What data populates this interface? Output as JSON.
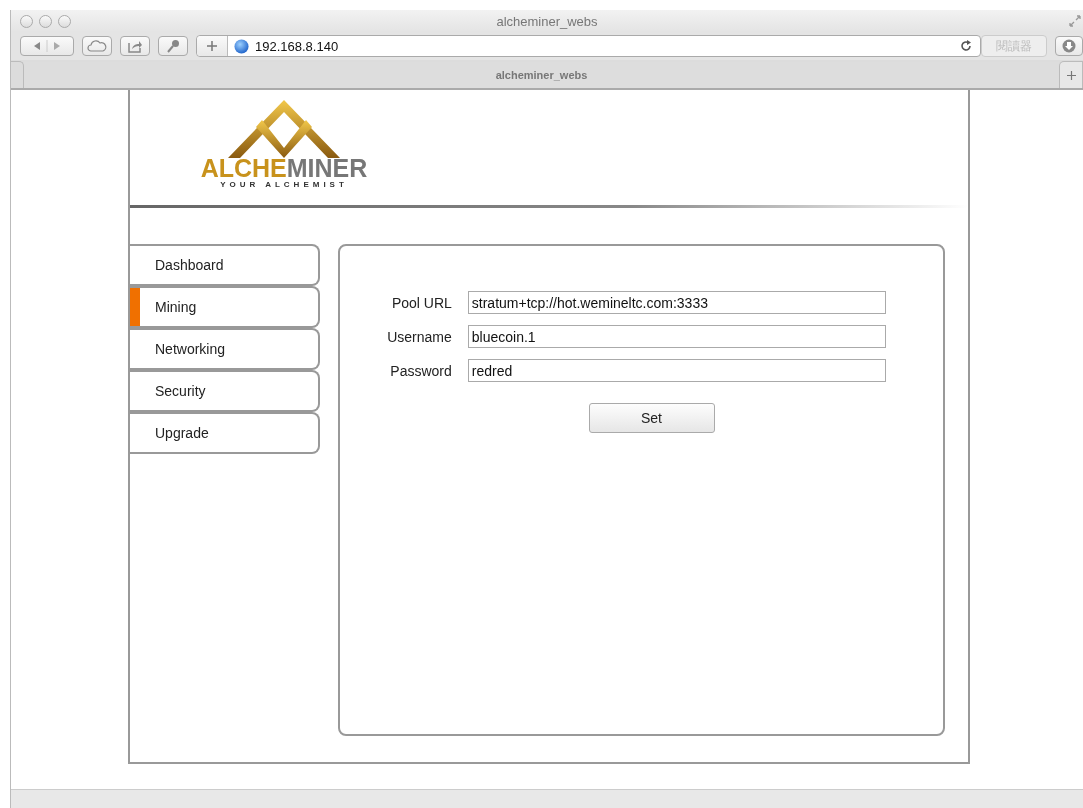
{
  "window": {
    "title": "alcheminer_webs"
  },
  "toolbar": {
    "address": "192.168.8.140",
    "reader_button": "閱讀器"
  },
  "tabs": [
    {
      "label": "alcheminer_webs",
      "selected": true
    }
  ],
  "logo": {
    "name_part_1": "ALCHE",
    "name_part_2": "MINER",
    "tagline": "YOUR ALCHEMIST"
  },
  "sidebar": {
    "items": [
      {
        "label": "Dashboard",
        "selected": false
      },
      {
        "label": "Mining",
        "selected": true
      },
      {
        "label": "Networking",
        "selected": false
      },
      {
        "label": "Security",
        "selected": false
      },
      {
        "label": "Upgrade",
        "selected": false
      }
    ]
  },
  "form": {
    "fields": [
      {
        "label": "Pool URL",
        "value": "stratum+tcp://hot.wemineltc.com:3333"
      },
      {
        "label": "Username",
        "value": "bluecoin.1"
      },
      {
        "label": "Password",
        "value": "redred"
      }
    ],
    "submit": "Set"
  }
}
